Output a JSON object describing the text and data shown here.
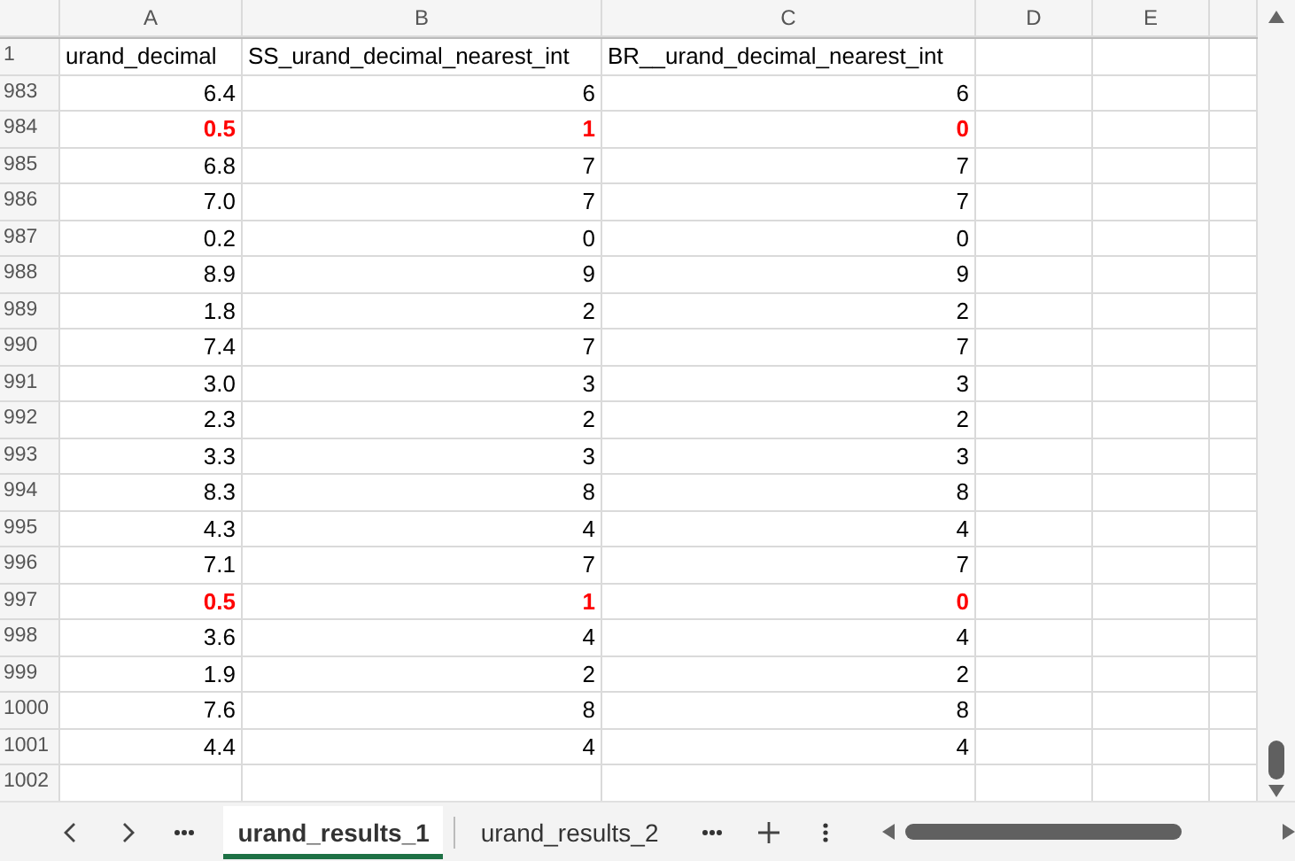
{
  "columns": [
    "A",
    "B",
    "C",
    "D",
    "E"
  ],
  "header_row": {
    "number": "1",
    "cells": [
      "urand_decimal",
      "SS_urand_decimal_nearest_int",
      "BR__urand_decimal_nearest_int"
    ]
  },
  "rows": [
    {
      "number": "983",
      "cells": [
        "6.4",
        "6",
        "6"
      ],
      "flagged": false
    },
    {
      "number": "984",
      "cells": [
        "0.5",
        "1",
        "0"
      ],
      "flagged": true
    },
    {
      "number": "985",
      "cells": [
        "6.8",
        "7",
        "7"
      ],
      "flagged": false
    },
    {
      "number": "986",
      "cells": [
        "7.0",
        "7",
        "7"
      ],
      "flagged": false
    },
    {
      "number": "987",
      "cells": [
        "0.2",
        "0",
        "0"
      ],
      "flagged": false
    },
    {
      "number": "988",
      "cells": [
        "8.9",
        "9",
        "9"
      ],
      "flagged": false
    },
    {
      "number": "989",
      "cells": [
        "1.8",
        "2",
        "2"
      ],
      "flagged": false
    },
    {
      "number": "990",
      "cells": [
        "7.4",
        "7",
        "7"
      ],
      "flagged": false
    },
    {
      "number": "991",
      "cells": [
        "3.0",
        "3",
        "3"
      ],
      "flagged": false
    },
    {
      "number": "992",
      "cells": [
        "2.3",
        "2",
        "2"
      ],
      "flagged": false
    },
    {
      "number": "993",
      "cells": [
        "3.3",
        "3",
        "3"
      ],
      "flagged": false
    },
    {
      "number": "994",
      "cells": [
        "8.3",
        "8",
        "8"
      ],
      "flagged": false
    },
    {
      "number": "995",
      "cells": [
        "4.3",
        "4",
        "4"
      ],
      "flagged": false
    },
    {
      "number": "996",
      "cells": [
        "7.1",
        "7",
        "7"
      ],
      "flagged": false
    },
    {
      "number": "997",
      "cells": [
        "0.5",
        "1",
        "0"
      ],
      "flagged": true
    },
    {
      "number": "998",
      "cells": [
        "3.6",
        "4",
        "4"
      ],
      "flagged": false
    },
    {
      "number": "999",
      "cells": [
        "1.9",
        "2",
        "2"
      ],
      "flagged": false
    },
    {
      "number": "1000",
      "cells": [
        "7.6",
        "8",
        "8"
      ],
      "flagged": false
    },
    {
      "number": "1001",
      "cells": [
        "4.4",
        "4",
        "4"
      ],
      "flagged": false
    },
    {
      "number": "1002",
      "cells": []
    }
  ],
  "sheet_tabs": [
    {
      "label": "urand_results_1",
      "selected": true
    },
    {
      "label": "urand_results_2",
      "selected": false
    }
  ]
}
